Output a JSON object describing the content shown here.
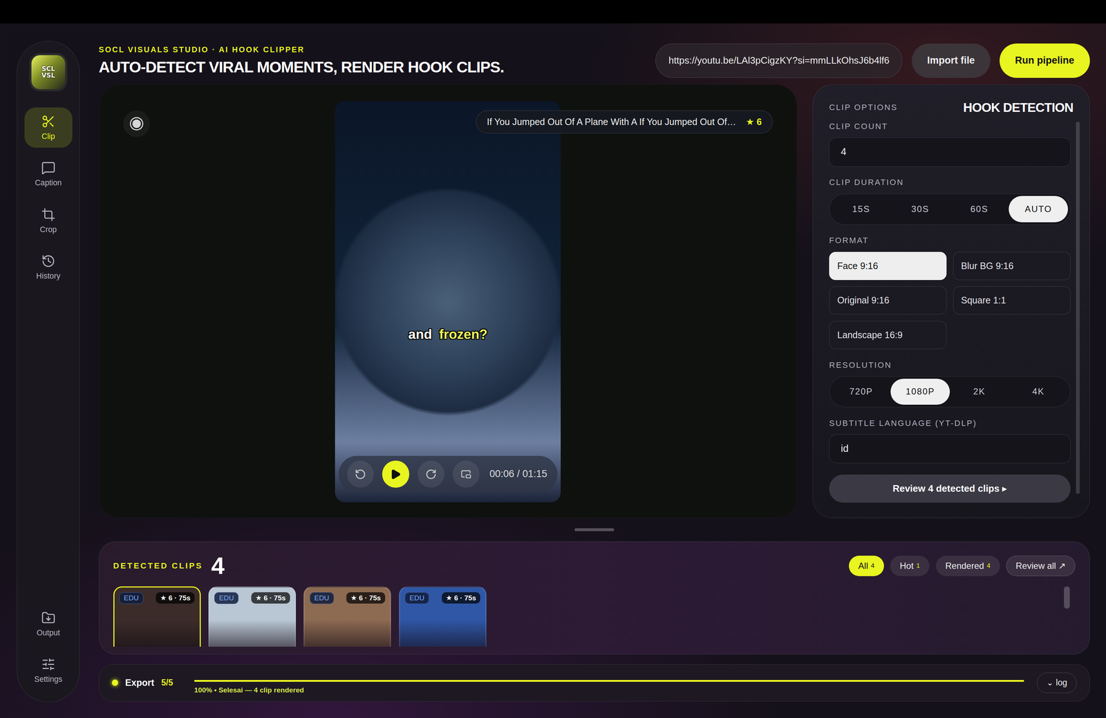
{
  "header": {
    "eyebrow": "SOCL VISUALS STUDIO · AI HOOK CLIPPER",
    "title": "AUTO-DETECT VIRAL MOMENTS, RENDER HOOK CLIPS.",
    "url": "https://youtu.be/LAl3pCigzKY?si=mmLLkOhsJ6b4lf6",
    "buttons": [
      {
        "label": "Import file",
        "kind": "secondary"
      },
      {
        "label": "Run pipeline",
        "kind": "primary"
      }
    ]
  },
  "sidebar": {
    "logo": [
      "SCL",
      "VSL"
    ],
    "items": [
      {
        "label": "Clip",
        "selected": true
      },
      {
        "label": "Caption",
        "selected": false
      },
      {
        "label": "Crop",
        "selected": false
      },
      {
        "label": "History",
        "selected": false
      }
    ],
    "bottom_items": [
      {
        "label": "Output",
        "selected": false
      },
      {
        "label": "Settings",
        "selected": false
      }
    ]
  },
  "preview": {
    "title": "If You Jumped Out Of A Plane With A If You Jumped Out Of…",
    "score": "★ 6",
    "caption": [
      {
        "text": "and",
        "highlighted": false
      },
      {
        "text": "frozen?",
        "highlighted": true
      }
    ],
    "time": "00:06 / 01:15",
    "playing": false
  },
  "options": {
    "section": "CLIP OPTIONS",
    "heading": "HOOK DETECTION",
    "clip_count": {
      "label": "CLIP COUNT",
      "value": "4"
    },
    "duration": {
      "label": "CLIP DURATION",
      "options": [
        {
          "label": "15S",
          "selected": false
        },
        {
          "label": "30S",
          "selected": false
        },
        {
          "label": "60S",
          "selected": false
        },
        {
          "label": "AUTO",
          "selected": true
        }
      ]
    },
    "format": {
      "label": "FORMAT",
      "options": [
        {
          "label": "Face 9:16",
          "selected": true
        },
        {
          "label": "Blur BG 9:16",
          "selected": false
        },
        {
          "label": "Original 9:16",
          "selected": false
        },
        {
          "label": "Square 1:1",
          "selected": false
        },
        {
          "label": "Landscape 16:9",
          "selected": false
        }
      ]
    },
    "resolution": {
      "label": "RESOLUTION",
      "options": [
        {
          "label": "720P",
          "selected": false
        },
        {
          "label": "1080P",
          "selected": true
        },
        {
          "label": "2K",
          "selected": false
        },
        {
          "label": "4K",
          "selected": false
        }
      ]
    },
    "subtitle": {
      "label": "SUBTITLE LANGUAGE (YT-DLP)",
      "value": "id"
    },
    "review_button": "Review 4 detected clips ▸"
  },
  "clips": {
    "label": "DETECTED CLIPS",
    "count": "4",
    "filters": [
      {
        "label": "All",
        "count": "4",
        "selected": true
      },
      {
        "label": "Hot",
        "count": "1",
        "selected": false
      },
      {
        "label": "Rendered",
        "count": "4",
        "selected": false
      }
    ],
    "review_all": "Review all ↗",
    "items": [
      {
        "tag": "EDU",
        "rating": "★ 6 · 75s",
        "selected": true,
        "color": "#3b2c29"
      },
      {
        "tag": "EDU",
        "rating": "★ 6 · 75s",
        "selected": false,
        "color": "#b9c6d3"
      },
      {
        "tag": "EDU",
        "rating": "★ 6 · 75s",
        "selected": false,
        "color": "#8d6a52"
      },
      {
        "tag": "EDU",
        "rating": "★ 6 · 75s",
        "selected": false,
        "color": "#2f57a6"
      }
    ]
  },
  "export": {
    "label": "Export",
    "count": "5/5",
    "level": 1,
    "status": "100% • Selesai — 4 clip rendered",
    "log_button": "⌄ log",
    "active": true
  }
}
